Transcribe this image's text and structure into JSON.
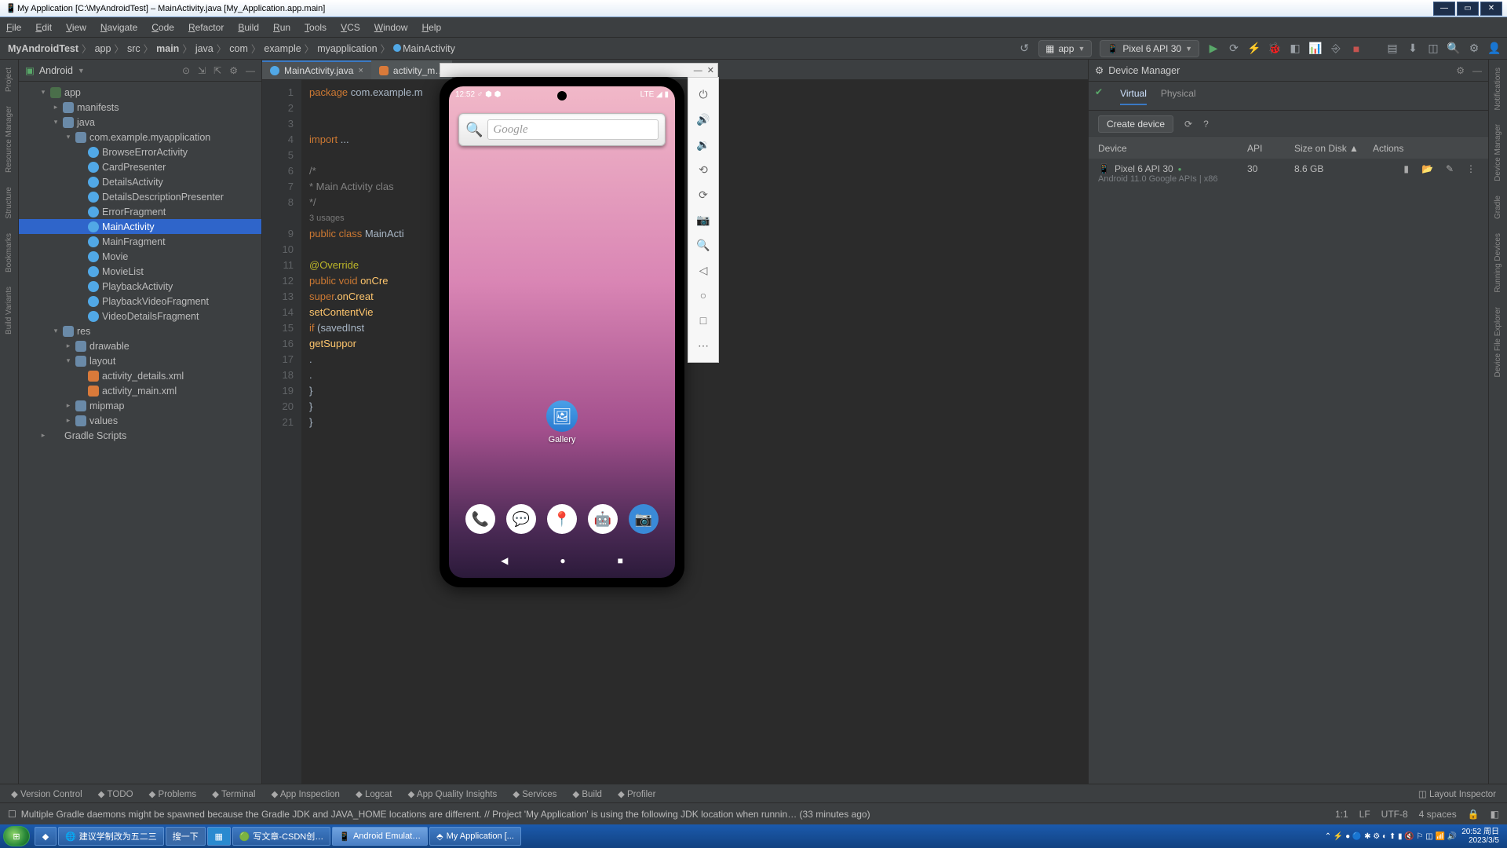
{
  "window": {
    "title": "My Application [C:\\MyAndroidTest] – MainActivity.java [My_Application.app.main]"
  },
  "menu": [
    "File",
    "Edit",
    "View",
    "Navigate",
    "Code",
    "Refactor",
    "Build",
    "Run",
    "Tools",
    "VCS",
    "Window",
    "Help"
  ],
  "breadcrumb": [
    "MyAndroidTest",
    "app",
    "src",
    "main",
    "java",
    "com",
    "example",
    "myapplication",
    "MainActivity"
  ],
  "runconfig": {
    "module": "app",
    "device": "Pixel 6 API 30"
  },
  "project": {
    "view": "Android",
    "tree": {
      "root": "app",
      "nodes": [
        {
          "l": 1,
          "exp": "▾",
          "icon": "mod",
          "label": "app"
        },
        {
          "l": 2,
          "exp": "▸",
          "icon": "folder",
          "label": "manifests"
        },
        {
          "l": 2,
          "exp": "▾",
          "icon": "folder",
          "label": "java"
        },
        {
          "l": 3,
          "exp": "▾",
          "icon": "folder",
          "label": "com.example.myapplication"
        },
        {
          "l": 4,
          "exp": "",
          "icon": "cls",
          "label": "BrowseErrorActivity"
        },
        {
          "l": 4,
          "exp": "",
          "icon": "cls",
          "label": "CardPresenter"
        },
        {
          "l": 4,
          "exp": "",
          "icon": "cls",
          "label": "DetailsActivity"
        },
        {
          "l": 4,
          "exp": "",
          "icon": "cls",
          "label": "DetailsDescriptionPresenter"
        },
        {
          "l": 4,
          "exp": "",
          "icon": "cls",
          "label": "ErrorFragment"
        },
        {
          "l": 4,
          "exp": "",
          "icon": "cls",
          "label": "MainActivity",
          "sel": true
        },
        {
          "l": 4,
          "exp": "",
          "icon": "cls",
          "label": "MainFragment"
        },
        {
          "l": 4,
          "exp": "",
          "icon": "cls",
          "label": "Movie"
        },
        {
          "l": 4,
          "exp": "",
          "icon": "cls",
          "label": "MovieList"
        },
        {
          "l": 4,
          "exp": "",
          "icon": "cls",
          "label": "PlaybackActivity"
        },
        {
          "l": 4,
          "exp": "",
          "icon": "cls",
          "label": "PlaybackVideoFragment"
        },
        {
          "l": 4,
          "exp": "",
          "icon": "cls",
          "label": "VideoDetailsFragment"
        },
        {
          "l": 2,
          "exp": "▾",
          "icon": "folder",
          "label": "res"
        },
        {
          "l": 3,
          "exp": "▸",
          "icon": "folder",
          "label": "drawable"
        },
        {
          "l": 3,
          "exp": "▾",
          "icon": "folder",
          "label": "layout"
        },
        {
          "l": 4,
          "exp": "",
          "icon": "xml",
          "label": "activity_details.xml"
        },
        {
          "l": 4,
          "exp": "",
          "icon": "xml",
          "label": "activity_main.xml"
        },
        {
          "l": 3,
          "exp": "▸",
          "icon": "folder",
          "label": "mipmap"
        },
        {
          "l": 3,
          "exp": "▸",
          "icon": "folder",
          "label": "values"
        },
        {
          "l": 1,
          "exp": "▸",
          "icon": "gradle",
          "label": "Gradle Scripts"
        }
      ]
    }
  },
  "editor": {
    "tabs": [
      {
        "label": "MainActivity.java",
        "active": true
      },
      {
        "label": "activity_m…",
        "active": false
      }
    ],
    "linestart": 1,
    "lines": [
      "package com.example.m",
      "",
      "",
      "import ...",
      "",
      "/*",
      " * Main Activity clas",
      " */",
      "3 usages",
      "public class MainActi",
      "",
      "    @Override",
      "    public void onCre",
      "        super.onCreat",
      "        setContentVie",
      "        if (savedInst",
      "            getSuppor",
      "                    .",
      "                    .",
      "        }",
      "    }",
      "}"
    ]
  },
  "devicemgr": {
    "title": "Device Manager",
    "tabs": [
      "Virtual",
      "Physical"
    ],
    "create": "Create device",
    "columns": [
      "Device",
      "API",
      "Size on Disk",
      "Actions"
    ],
    "devices": [
      {
        "name": "Pixel 6 API 30",
        "sub": "Android 11.0 Google APIs | x86",
        "api": "30",
        "size": "8.6 GB",
        "running": true
      }
    ]
  },
  "bottom_tools": [
    "Version Control",
    "TODO",
    "Problems",
    "Terminal",
    "App Inspection",
    "Logcat",
    "App Quality Insights",
    "Services",
    "Build",
    "Profiler"
  ],
  "bottom_tools_right": "Layout Inspector",
  "status": {
    "message": "Multiple Gradle daemons might be spawned because the Gradle JDK and JAVA_HOME locations are different. // Project 'My Application' is using the following JDK location when runnin… (33 minutes ago)",
    "cursor": "1:1",
    "eol": "LF",
    "enc": "UTF-8",
    "indent": "4 spaces"
  },
  "left_strip": [
    "Project",
    "Resource Manager",
    "Structure",
    "Bookmarks",
    "Build Variants"
  ],
  "right_strip": [
    "Notifications",
    "Device Manager",
    "Gradle",
    "Running Devices",
    "Device File Explorer"
  ],
  "emulator": {
    "statusbar_time": "12:52",
    "statusbar_right": "LTE ◢ ▮",
    "search_placeholder": "Google",
    "gallery_label": "Gallery",
    "dock": [
      "phone",
      "messages",
      "maps",
      "android",
      "camera"
    ],
    "controls": [
      "power",
      "vol-up",
      "vol-down",
      "rotate-left",
      "rotate-right",
      "camera",
      "zoom",
      "back",
      "home",
      "overview",
      "more"
    ]
  },
  "taskbar": {
    "items": [
      {
        "label": "建议学制改为五二三",
        "browser": true
      },
      {
        "label": "搜一下"
      },
      {
        "label": "",
        "icon": "tiles"
      },
      {
        "label": "写文章-CSDN创…",
        "icon": "chrome"
      },
      {
        "label": "Android Emulat…",
        "icon": "emu",
        "active": true
      },
      {
        "label": "My Application [...",
        "icon": "as"
      }
    ],
    "clock": {
      "time": "20:52",
      "date": "2023/3/5",
      "day": "周日"
    }
  }
}
